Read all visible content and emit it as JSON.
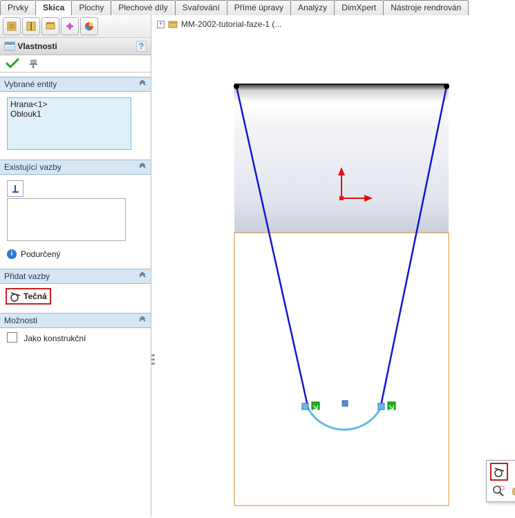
{
  "tabs": {
    "items": [
      "Prvky",
      "Skica",
      "Plochy",
      "Plechové díly",
      "Svařování",
      "Přímé úpravy",
      "Analýzy",
      "DimXpert",
      "Nástroje rendrován"
    ],
    "active_index": 1
  },
  "panel": {
    "title": "Vlastnosti",
    "help": "?"
  },
  "selected_entities": {
    "header": "Vybrané entity",
    "items": [
      "Hrana<1>",
      "Oblouk1"
    ]
  },
  "existing": {
    "header": "Existující vazby",
    "status": "Podurčený"
  },
  "add": {
    "header": "Přidat vazby",
    "button": "Tečná"
  },
  "options": {
    "header": "Možnosti",
    "construction": "Jako konstrukční"
  },
  "tree": {
    "label": "MM-2002-tutorial-faze-1  (..."
  }
}
